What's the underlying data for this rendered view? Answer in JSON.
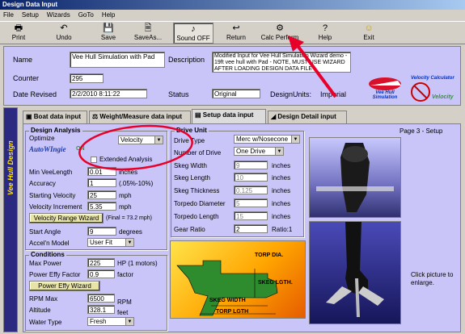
{
  "window": {
    "title": "Design Data Input"
  },
  "menu": [
    "File",
    "Setup",
    "Wizards",
    "GoTo",
    "Help"
  ],
  "toolbar": [
    {
      "label": "Print",
      "icon": "printer-icon",
      "glyph": "🖶"
    },
    {
      "label": "Undo",
      "icon": "undo-icon",
      "glyph": "↶"
    },
    {
      "label": "Save",
      "icon": "save-icon",
      "glyph": "💾"
    },
    {
      "label": "SaveAs...",
      "icon": "save-as-icon",
      "glyph": "🗎"
    },
    {
      "label": "Sound OFF",
      "icon": "sound-icon",
      "glyph": "♪"
    },
    {
      "label": "Return",
      "icon": "return-icon",
      "glyph": "↩"
    },
    {
      "label": "Calc Perform",
      "icon": "calc-perform-icon",
      "glyph": "⚙"
    },
    {
      "label": "Help",
      "icon": "help-icon",
      "glyph": "?"
    },
    {
      "label": "Exit",
      "icon": "exit-icon",
      "glyph": "☺"
    }
  ],
  "header": {
    "name_label": "Name",
    "name_value": "Vee Hull Simulation with Pad",
    "counter_label": "Counter",
    "counter_value": "295",
    "date_label": "Date Revised",
    "date_value": "2/2/2010 8:11:22",
    "description_label": "Description",
    "description_value": "Modified Input for Vee Hull Simulation Wizard demo - 19ft vee hull with Pad - NOTE, MUST USE WIZARD AFTER LOADING DESIGN DATA FILE",
    "status_label": "Status",
    "status_value": "Original",
    "units_label": "DesignUnits:",
    "units_value": "Imperial"
  },
  "logos": {
    "vee_hull": "Vee Hull Simulation",
    "velocity": "Velocity Calculator",
    "vee_hull_design": "Vee Hull Design"
  },
  "tabs": [
    "Boat data input",
    "Weight/Measure data input",
    "Setup data input",
    "Design Detail input"
  ],
  "page_label": "Page 3 - Setup",
  "design_analysis": {
    "title": "Design Analysis",
    "optimize_label": "Optimize",
    "optimize_value": "Velocity",
    "autowingie": "AutoWIngie",
    "autowingie_state": "ON",
    "extended_label": "Extended Analysis",
    "min_vee_label": "Min VeeLength",
    "min_vee_value": "0.01",
    "min_vee_unit": "inches",
    "accuracy_label": "Accuracy",
    "accuracy_value": "1",
    "accuracy_unit": "(.05%-10%)",
    "start_vel_label": "Starting Velocity",
    "start_vel_value": "25",
    "start_vel_unit": "mph",
    "vel_inc_label": "Velocity Increment",
    "vel_inc_value": "5.35",
    "vel_inc_unit": "mph",
    "vel_range_button": "Velocity Range Wizard",
    "final_text": "(Final = 73.2 mph)",
    "start_angle_label": "Start Angle",
    "start_angle_value": "9",
    "start_angle_unit": "degrees",
    "accel_label": "Accel'n Model",
    "accel_value": "User Fit"
  },
  "conditions": {
    "title": "Conditions",
    "max_power_label": "Max Power",
    "max_power_value": "225",
    "max_power_unit": "HP (1 motors)",
    "effy_label": "Power Effy Factor",
    "effy_value": "0.9",
    "effy_unit": "factor",
    "effy_button": "Power Effy Wizard",
    "rpm_label": "RPM Max",
    "rpm_value": "6500",
    "rpm_unit": "RPM",
    "alt_label": "Altitude",
    "alt_value": "328.1",
    "alt_unit": "feet",
    "water_label": "Water Type",
    "water_value": "Fresh"
  },
  "drive_unit": {
    "title": "Drive Unit",
    "type_label": "Drive Type",
    "type_value": "Merc w/Nosecone",
    "num_label": "Number of Drive",
    "num_value": "One Drive",
    "skeg_w_label": "Skeg Width",
    "skeg_w_value": "9",
    "skeg_w_unit": "inches",
    "skeg_l_label": "Skeg Length",
    "skeg_l_value": "10",
    "skeg_l_unit": "inches",
    "skeg_t_label": "Skeg Thickness",
    "skeg_t_value": "0.125",
    "skeg_t_unit": "inches",
    "torp_d_label": "Torpedo Diameter",
    "torp_d_value": "5",
    "torp_d_unit": "inches",
    "torp_l_label": "Torpedo Length",
    "torp_l_value": "15",
    "torp_l_unit": "inches",
    "gear_label": "Gear Ratio",
    "gear_value": "2",
    "gear_unit": "Ratio:1"
  },
  "diagram": {
    "torp_dia": "TORP DIA.",
    "skeg_lgth": "SKEG LGTH.",
    "skeg_width": "SKEG WIDTH",
    "torp_lgth": "TORP LGTH"
  },
  "enlarge_text": "Click picture to enlarge.",
  "colors": {
    "panel": "#c9c5f8",
    "titlebar": "#0a246a",
    "annotation": "#e8002a",
    "button": "#e8e4a8"
  }
}
